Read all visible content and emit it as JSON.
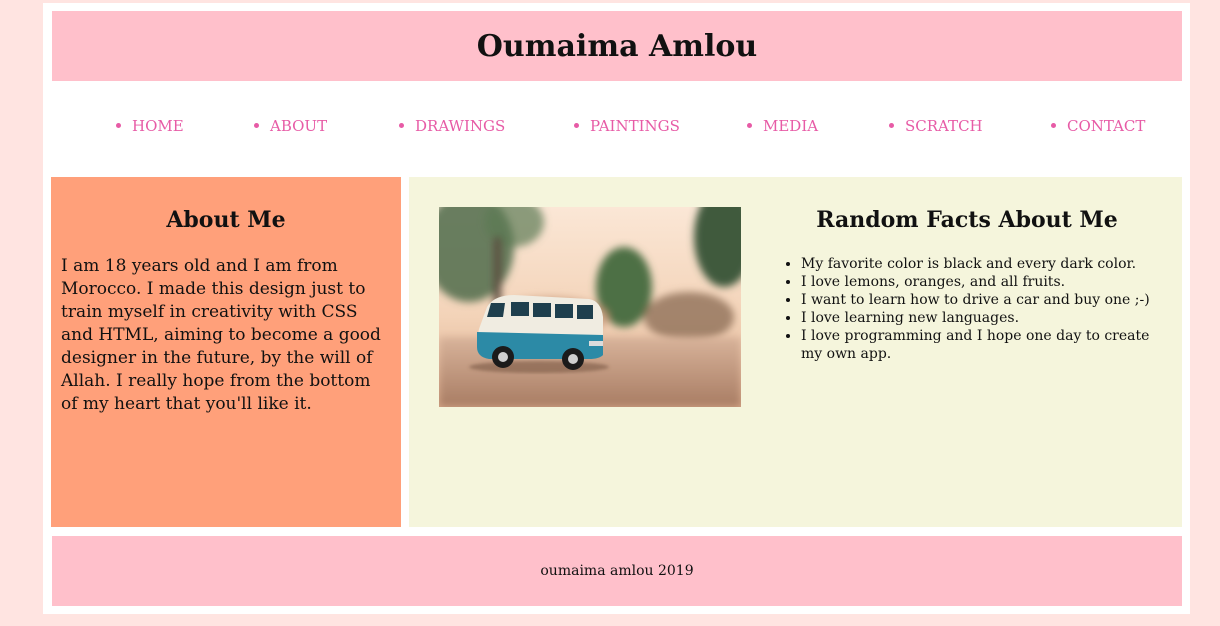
{
  "header": {
    "title": "Oumaima Amlou"
  },
  "nav": {
    "items": [
      {
        "label": "HOME"
      },
      {
        "label": "ABOUT"
      },
      {
        "label": "DRAWINGS"
      },
      {
        "label": "PAINTINGS"
      },
      {
        "label": "MEDIA"
      },
      {
        "label": "SCRATCH"
      },
      {
        "label": "CONTACT"
      }
    ]
  },
  "about": {
    "heading": "About Me",
    "text": "I am 18 years old and I am from Morocco. I made this design just to train myself in creativity with CSS and HTML, aiming to become a good designer in the future, by the will of Allah. I really hope from the bottom of my heart that you'll like it."
  },
  "facts": {
    "heading": "Random Facts About Me",
    "items": [
      "My favorite color is black and every dark color.",
      "I love lemons, oranges, and all fruits.",
      "I want to learn how to drive a car and buy one ;-)",
      "I love learning new languages.",
      "I love programming and I hope one day to create my own app."
    ]
  },
  "footer": {
    "text": "oumaima amlou 2019"
  },
  "colors": {
    "background": "#ffe4e1",
    "header_footer": "#ffc0cb",
    "nav_link": "#e75ba6",
    "about_panel": "#ffa07a",
    "facts_panel": "#f5f5dc"
  }
}
